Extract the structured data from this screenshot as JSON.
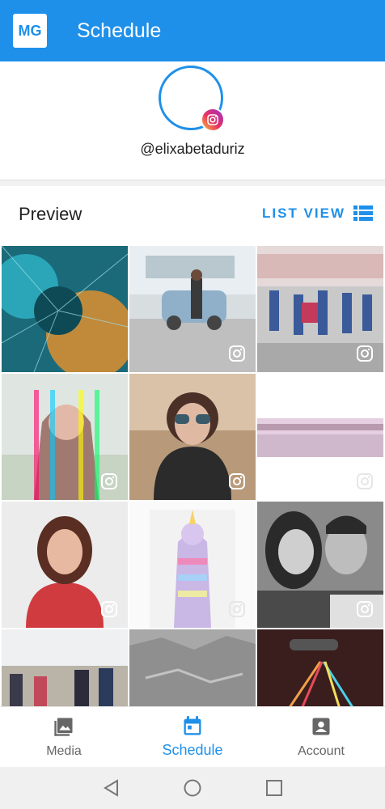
{
  "app": {
    "logo_text": "MG",
    "title": "Schedule"
  },
  "profile": {
    "handle": "@elixabetaduriz",
    "badge_icon": "instagram-icon"
  },
  "preview": {
    "title": "Preview",
    "list_view_label": "LIST VIEW",
    "list_view_icon": "list-icon"
  },
  "grid": {
    "tiles": [
      {
        "subject": "peacock feather",
        "has_ig_mark": false
      },
      {
        "subject": "woman posing on car",
        "has_ig_mark": true
      },
      {
        "subject": "group running race",
        "has_ig_mark": true
      },
      {
        "subject": "woman with rainbow effect",
        "has_ig_mark": true
      },
      {
        "subject": "woman wearing sunglasses",
        "has_ig_mark": true
      },
      {
        "subject": "beach promenade",
        "has_ig_mark": true
      },
      {
        "subject": "smiling woman in red",
        "has_ig_mark": true
      },
      {
        "subject": "person in unicorn costume",
        "has_ig_mark": true
      },
      {
        "subject": "couple selfie black and white",
        "has_ig_mark": true
      },
      {
        "subject": "hikers group",
        "has_ig_mark": false
      },
      {
        "subject": "rocky cliff",
        "has_ig_mark": false
      },
      {
        "subject": "light trails in car",
        "has_ig_mark": false
      }
    ]
  },
  "bottom_nav": {
    "items": [
      {
        "label": "Media",
        "icon": "image-icon",
        "active": false
      },
      {
        "label": "Schedule",
        "icon": "calendar-icon",
        "active": true
      },
      {
        "label": "Account",
        "icon": "account-box-icon",
        "active": false
      }
    ]
  },
  "colors": {
    "primary": "#1e90ea",
    "inactive": "#666666"
  },
  "system_nav": {
    "buttons": [
      "back-icon",
      "home-icon",
      "recents-icon"
    ]
  }
}
